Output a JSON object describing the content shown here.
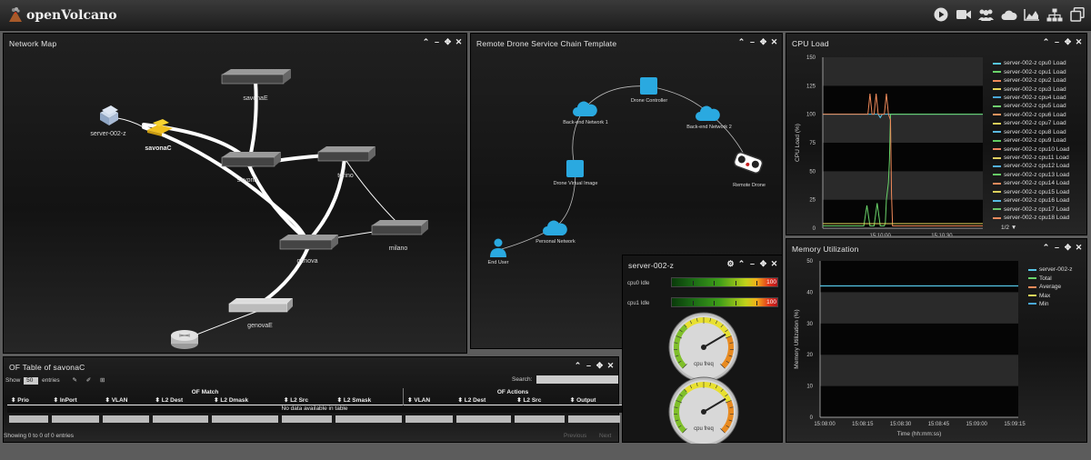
{
  "app": {
    "title": "openVolcano"
  },
  "toolbar": [
    "play-icon",
    "video-camera-icon",
    "users-icon",
    "cloud-icon",
    "area-chart-icon",
    "sitemap-icon",
    "copy-windows-icon"
  ],
  "network_map": {
    "title": "Network Map",
    "nodes": {
      "savonaE": "savonaE",
      "server": "server-002-z",
      "savonaC": "savonaC",
      "savona": "savona",
      "torino": "torino",
      "genova": "genova",
      "milano": "milano",
      "genovaE": "genovaE"
    }
  },
  "service_chain": {
    "title": "Remote Drone Service Chain Template",
    "nodes": {
      "drone_controller": "Drone Controller",
      "backend1": "Back-end Network 1",
      "backend2": "Back-end Network 2",
      "remote_drone": "Remote Drone",
      "virtual_image": "Drone Virtual Image",
      "personal_network": "Personal Network",
      "end_user": "End User"
    }
  },
  "cpu_load": {
    "title": "CPU Load",
    "pager": "1/2 ▼"
  },
  "memory": {
    "title": "Memory Utilization"
  },
  "of_table": {
    "title": "OF Table of savonaC",
    "show": "Show",
    "show_value": "50",
    "entries": "entries",
    "search": "Search:",
    "group_match": "OF Match",
    "group_actions": "OF Actions",
    "columns": [
      "Prio",
      "InPort",
      "VLAN",
      "L2 Dest",
      "L2 Dmask",
      "L2 Src",
      "L2 Smask",
      "VLAN",
      "L2 Dest",
      "L2 Src",
      "Output"
    ],
    "empty": "No data available in table",
    "info": "Showing 0 to 0 of 0 entries",
    "prev": "Previous",
    "next": "Next"
  },
  "server_panel": {
    "title": "server-002-z",
    "meters": [
      {
        "label": "cpu0 Idle",
        "value": "100"
      },
      {
        "label": "cpu1 Idle",
        "value": "100"
      }
    ],
    "gauges": [
      {
        "label": "cpu freq",
        "level": 0.72
      },
      {
        "label": "cpu freq",
        "level": 0.72
      }
    ]
  },
  "colors": {
    "accent": "#1fa8e0",
    "panel": "#141414"
  },
  "chart_data": [
    {
      "type": "line",
      "title": "CPU Load",
      "xlabel": "Time (hh:mm:ss)",
      "ylabel": "CPU Load (%)",
      "ylim": [
        0,
        150
      ],
      "yticks": [
        "0",
        "25",
        "50",
        "75",
        "100",
        "125",
        "150"
      ],
      "xticks": [
        {
          "t": "15:10:00",
          "x": 10
        },
        {
          "t": "15:10:30",
          "x": 40
        }
      ],
      "xlim": [
        -18,
        60
      ],
      "legend": [
        "server-002-z cpu0 Load",
        "server-002-z cpu1 Load",
        "server-002-z cpu2 Load",
        "server-002-z cpu3 Load",
        "server-002-z cpu4 Load",
        "server-002-z cpu5 Load",
        "server-002-z cpu6 Load",
        "server-002-z cpu7 Load",
        "server-002-z cpu8 Load",
        "server-002-z cpu9 Load",
        "server-002-z cpu10 Load",
        "server-002-z cpu11 Load",
        "server-002-z cpu12 Load",
        "server-002-z cpu13 Load",
        "server-002-z cpu14 Load",
        "server-002-z cpu15 Load",
        "server-002-z cpu16 Load",
        "server-002-z cpu17 Load",
        "server-002-z cpu18 Load"
      ],
      "legend_colors": [
        "#56c6e6",
        "#6ad46a",
        "#f08a5a",
        "#e8d85a",
        "#4aa8d8",
        "#6fd06f",
        "#f0945e",
        "#d8cc58",
        "#5ab8e0",
        "#62cc62",
        "#ee8660",
        "#e0d060",
        "#52b0e0",
        "#66ca66",
        "#ec8a5c",
        "#dcd05c",
        "#58bce2",
        "#6ac86a",
        "#e88a5e"
      ],
      "series": [
        {
          "color": "#56c6e6",
          "values": [
            [
              -18,
              100
            ],
            [
              0,
              100
            ],
            [
              9,
              100
            ],
            [
              10,
              97
            ],
            [
              11,
              100
            ],
            [
              60,
              100
            ]
          ]
        },
        {
          "color": "#6ad46a",
          "values": [
            [
              -18,
              2
            ],
            [
              0,
              2
            ],
            [
              2,
              2
            ],
            [
              3.5,
              20
            ],
            [
              5,
              2
            ],
            [
              7,
              2
            ],
            [
              8.5,
              22
            ],
            [
              10,
              2
            ],
            [
              12,
              2
            ],
            [
              12.5,
              5
            ],
            [
              13,
              25
            ],
            [
              14,
              40
            ],
            [
              14.5,
              60
            ],
            [
              15,
              100
            ],
            [
              60,
              100
            ]
          ]
        },
        {
          "color": "#f08a5a",
          "values": [
            [
              -18,
              100
            ],
            [
              0,
              100
            ],
            [
              4,
              100
            ],
            [
              5,
              118
            ],
            [
              6,
              100
            ],
            [
              7,
              100
            ],
            [
              8,
              118
            ],
            [
              9,
              100
            ],
            [
              12,
              100
            ],
            [
              13,
              118
            ],
            [
              14,
              100
            ],
            [
              15,
              95
            ],
            [
              15.5,
              30
            ],
            [
              16,
              2
            ],
            [
              60,
              2
            ]
          ]
        },
        {
          "color": "#e8d85a",
          "values": [
            [
              -18,
              4
            ],
            [
              60,
              4
            ]
          ]
        }
      ]
    },
    {
      "type": "line",
      "title": "Memory Utilization",
      "xlabel": "Time (hh:mm:ss)",
      "ylabel": "Memory Utilization (%)",
      "ylim": [
        0,
        50
      ],
      "yticks": [
        "0",
        "10",
        "20",
        "30",
        "40",
        "50"
      ],
      "xticks": [
        "15:08:00",
        "15:08:15",
        "15:08:30",
        "15:08:45",
        "15:09:00",
        "15:09:15"
      ],
      "legend": [
        "server-002-z",
        "Total",
        "Average",
        "Max",
        "Min"
      ],
      "legend_colors": [
        "#56c6e6",
        "#6ad46a",
        "#f08a5a",
        "#e8d85a",
        "#4aa8d8"
      ],
      "series": [
        {
          "name": "server-002-z",
          "color": "#56c6e6",
          "values": [
            42,
            42,
            42,
            42,
            42,
            42
          ]
        }
      ]
    }
  ]
}
